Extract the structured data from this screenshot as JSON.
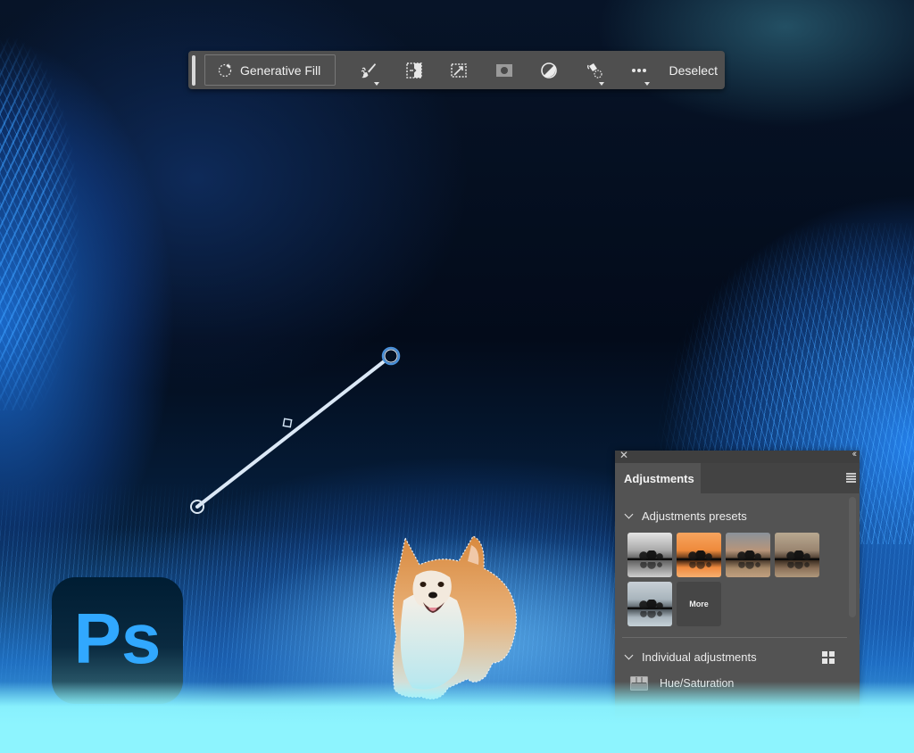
{
  "app": {
    "name": "Adobe Photoshop",
    "logo_text": "Ps",
    "brand_color": "#31a8ff"
  },
  "taskbar": {
    "generative_fill_label": "Generative Fill",
    "tools": [
      {
        "icon": "brush-select-icon",
        "has_dropdown": true
      },
      {
        "icon": "select-subject-icon",
        "has_dropdown": false
      },
      {
        "icon": "transform-selection-icon",
        "has_dropdown": false
      },
      {
        "icon": "create-mask-icon",
        "has_dropdown": false
      },
      {
        "icon": "adjustment-layer-icon",
        "has_dropdown": false
      },
      {
        "icon": "fill-selection-icon",
        "has_dropdown": true
      },
      {
        "icon": "more-options-icon",
        "has_dropdown": true
      }
    ],
    "deselect_label": "Deselect"
  },
  "adjustments_panel": {
    "tab_label": "Adjustments",
    "presets_section": {
      "title": "Adjustments presets",
      "expanded": true,
      "presets": [
        {
          "name": "preset-bw",
          "tone": "#bdbdbd"
        },
        {
          "name": "preset-warm-orange",
          "tone": "#f39a55"
        },
        {
          "name": "preset-faded-warm",
          "tone": "#9b8e80"
        },
        {
          "name": "preset-sepia",
          "tone": "#a48d74"
        },
        {
          "name": "preset-cool-blue",
          "tone": "#b7c2c8"
        }
      ],
      "more_label": "More"
    },
    "individual_section": {
      "title": "Individual adjustments",
      "expanded": true,
      "items": [
        {
          "label": "Hue/Saturation",
          "icon": "hue-saturation-icon"
        }
      ]
    }
  },
  "canvas": {
    "gradient_tool_visible": true,
    "selection_subject": "corgi"
  }
}
